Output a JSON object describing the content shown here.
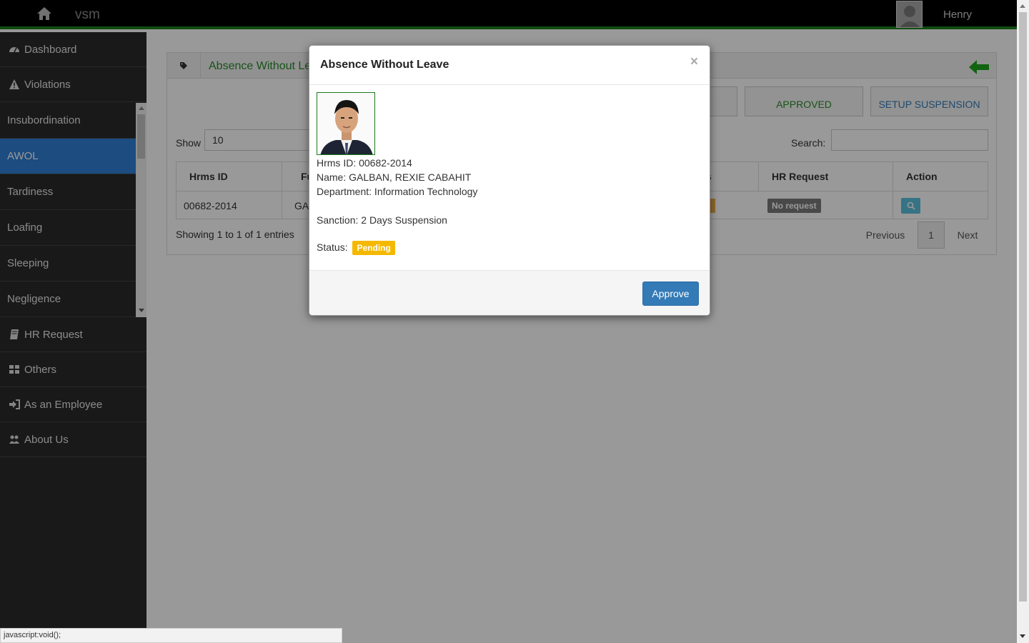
{
  "app": {
    "brand": "vsm",
    "user_name": "Henry"
  },
  "sidebar": {
    "items": [
      {
        "label": "Dashboard",
        "icon": "dashboard-icon"
      },
      {
        "label": "Violations",
        "icon": "warning-icon"
      },
      {
        "label": "HR Request",
        "icon": "book-icon"
      },
      {
        "label": "Others",
        "icon": "grid-icon"
      },
      {
        "label": "As an Employee",
        "icon": "sign-in-icon"
      },
      {
        "label": "About Us",
        "icon": "users-icon"
      }
    ],
    "violations": [
      "Insubordination",
      "AWOL",
      "Tardiness",
      "Loafing",
      "Sleeping",
      "Negligence"
    ],
    "active": "AWOL"
  },
  "page": {
    "title": "Absence Without Le",
    "tabs": {
      "approved": "APPROVED",
      "setup_suspension": "SETUP SUSPENSION"
    },
    "show_label": "Show",
    "show_value": "10",
    "search_label": "Search:",
    "table": {
      "headers": {
        "hrms_id": "Hrms ID",
        "fullname": "Fu",
        "status": "s",
        "hr_request": "HR Request",
        "action": "Action"
      },
      "row": {
        "hrms_id": "00682-2014",
        "fullname": "GA",
        "hr_request": "No request"
      }
    },
    "showing": "Showing 1 to 1 of 1 entries",
    "pager": {
      "previous": "Previous",
      "current": "1",
      "next": "Next"
    }
  },
  "modal": {
    "title": "Absence Without Leave",
    "close": "×",
    "hrms_id": "Hrms ID: 00682-2014",
    "name": "Name: GALBAN, REXIE CABAHIT",
    "department": "Department: Information Technology",
    "sanction": "Sanction: 2 Days Suspension",
    "status_label": "Status:",
    "status_value": "Pending",
    "approve_label": "Approve"
  },
  "statusbar": "javascript:void();",
  "colors": {
    "accent_green": "#1b7d1b",
    "active_blue": "#2f7fd6",
    "pending": "#f5b800",
    "primary": "#337ab7"
  }
}
